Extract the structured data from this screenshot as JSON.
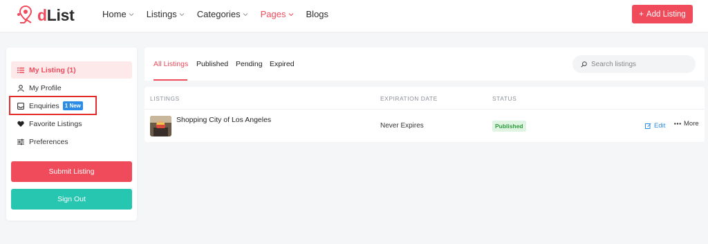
{
  "header": {
    "logo_text": "dList",
    "logo_letter": "d",
    "logo_rest": "List",
    "nav": [
      {
        "label": "Home",
        "has_dropdown": true
      },
      {
        "label": "Listings",
        "has_dropdown": true
      },
      {
        "label": "Categories",
        "has_dropdown": true
      },
      {
        "label": "Pages",
        "has_dropdown": true,
        "active": true
      },
      {
        "label": "Blogs",
        "has_dropdown": false
      }
    ],
    "add_button": "Add Listing"
  },
  "sidebar": {
    "items": [
      {
        "label": "My Listing (1)",
        "icon": "list-icon",
        "active": true
      },
      {
        "label": "My Profile",
        "icon": "user-icon"
      },
      {
        "label": "Enquiries",
        "icon": "inbox-icon",
        "badge": "1 New"
      },
      {
        "label": "Favorite Listings",
        "icon": "heart-icon"
      },
      {
        "label": "Preferences",
        "icon": "sliders-icon"
      }
    ],
    "submit_button": "Submit Listing",
    "signout_button": "Sign Out"
  },
  "tabs": [
    {
      "label": "All Listings",
      "active": true
    },
    {
      "label": "Published"
    },
    {
      "label": "Pending"
    },
    {
      "label": "Expired"
    }
  ],
  "search": {
    "placeholder": "Search listings"
  },
  "table": {
    "columns": [
      "LISTINGS",
      "EXPIRATION DATE",
      "STATUS"
    ],
    "rows": [
      {
        "title": "Shopping City of Los Angeles",
        "expiration": "Never Expires",
        "status": "Published",
        "edit_label": "Edit",
        "more_label": "More"
      }
    ]
  },
  "colors": {
    "accent": "#f04b5b",
    "teal": "#26c6b0",
    "blue": "#2b8ce6",
    "published_bg": "#dff5e1",
    "published_text": "#2e9a3f"
  }
}
